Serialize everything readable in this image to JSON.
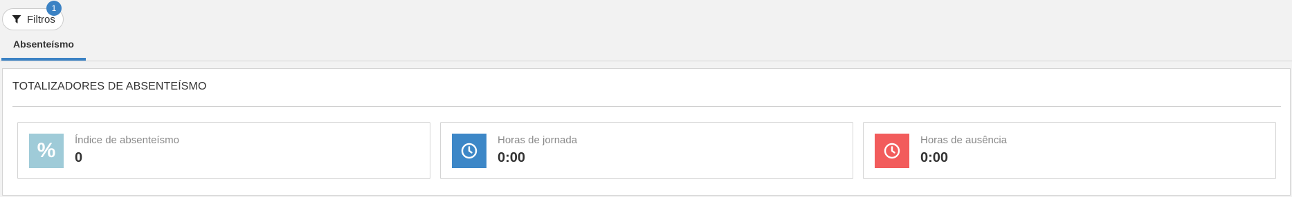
{
  "filter": {
    "label": "Filtros",
    "badge_count": "1",
    "icon": "filter-icon"
  },
  "tabs": [
    {
      "label": "Absenteísmo",
      "active": true
    }
  ],
  "panel": {
    "title": "TOTALIZADORES DE ABSENTEÍSMO"
  },
  "cards": [
    {
      "label": "Índice de absenteísmo",
      "value": "0",
      "icon": "percent-icon",
      "color": "#9fcbd8"
    },
    {
      "label": "Horas de jornada",
      "value": "0:00",
      "icon": "clock-icon",
      "color": "#3d87c7"
    },
    {
      "label": "Horas de ausência",
      "value": "0:00",
      "icon": "clock-icon",
      "color": "#f25c5c"
    }
  ],
  "colors": {
    "accent": "#3b82c4",
    "background": "#f2f2f2"
  }
}
